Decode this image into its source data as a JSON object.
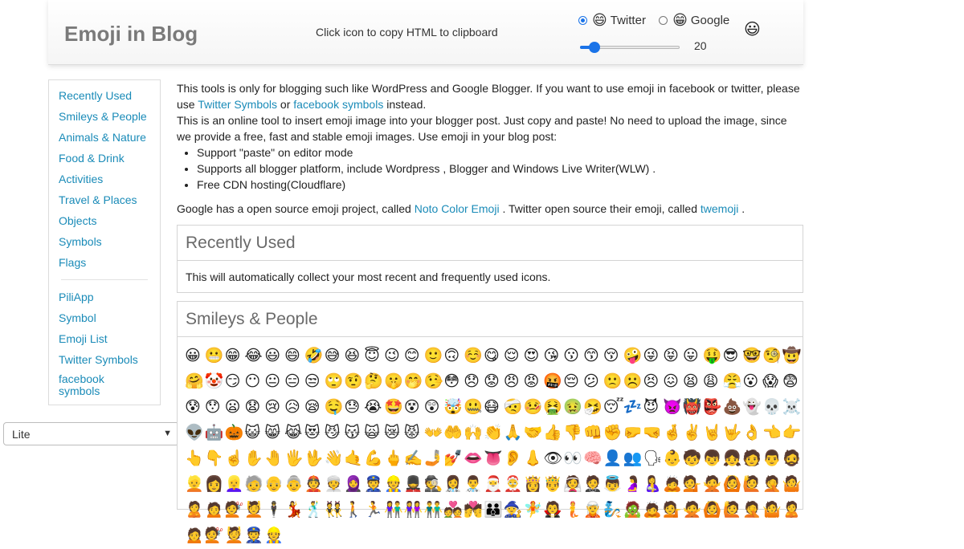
{
  "header": {
    "title": "Emoji in Blog",
    "tagline": "Click icon to copy HTML to clipboard",
    "options": [
      {
        "label": "Twitter",
        "emoji": "😄",
        "selected": true
      },
      {
        "label": "Google",
        "emoji": "😁",
        "selected": false
      }
    ],
    "preview_emoji": "😃",
    "size_slider": {
      "value": 20,
      "min": 8,
      "max": 128
    },
    "size_value": "20"
  },
  "sidebar": {
    "categories": [
      "Recently Used",
      "Smileys & People",
      "Animals & Nature",
      "Food & Drink",
      "Activities",
      "Travel & Places",
      "Objects",
      "Symbols",
      "Flags"
    ],
    "links": [
      "PiliApp",
      "Symbol",
      "Emoji List",
      "Twitter Symbols",
      "facebook symbols"
    ],
    "select_value": "Lite"
  },
  "intro": {
    "p1_before": "This tools is only for blogging such like WordPress and Google Blogger. If you want to use emoji in facebook or twitter, please use ",
    "p1_link1": "Twitter Symbols",
    "p1_or": " or ",
    "p1_link2": "facebook symbols",
    "p1_after": " instead.",
    "p2": "This is an online tool to insert emoji image into your blogger post. Just copy and paste! No need to upload the image, since we provide a free, fast and stable emoji images. Use emoji in your blog post:",
    "bullets": [
      "Support \"paste\" on editor mode",
      "Supports all blogger platform, include Wordpress , Blogger and Windows Live Writer(WLW) .",
      "Free CDN hosting(Cloudflare)"
    ],
    "p3_before": "Google has a open source emoji project, called ",
    "p3_link1": "Noto Color Emoji",
    "p3_mid": " . Twitter open source their emoji, called ",
    "p3_link2": "twemoji",
    "p3_after": " ."
  },
  "recent_panel": {
    "title": "Recently Used",
    "body": "This will automatically collect your most recent and frequently used icons."
  },
  "smileys_panel": {
    "title": "Smileys & People",
    "emojis": [
      "😀",
      "😬",
      "😁",
      "😂",
      "😃",
      "😄",
      "🤣",
      "😅",
      "😆",
      "😇",
      "😉",
      "😊",
      "🙂",
      "🙃",
      "☺️",
      "😋",
      "😌",
      "😍",
      "😘",
      "😗",
      "😙",
      "😚",
      "🤪",
      "😜",
      "😝",
      "😛",
      "🤑",
      "😎",
      "🤓",
      "🧐",
      "🤠",
      "🤗",
      "🤡",
      "😏",
      "😶",
      "😐",
      "😑",
      "😒",
      "🙄",
      "🤨",
      "🤔",
      "🤫",
      "🤭",
      "🤥",
      "😳",
      "😞",
      "😟",
      "😠",
      "😡",
      "🤬",
      "😔",
      "😕",
      "🙁",
      "☹️",
      "😣",
      "😖",
      "😫",
      "😩",
      "😤",
      "😮",
      "😱",
      "😨",
      "😰",
      "😯",
      "😦",
      "😧",
      "😢",
      "😥",
      "😪",
      "🤤",
      "😓",
      "😭",
      "🤩",
      "😵",
      "😲",
      "🤯",
      "🤐",
      "😷",
      "🤕",
      "🤒",
      "🤮",
      "🤢",
      "🤧",
      "😴",
      "💤",
      "😈",
      "👿",
      "👹",
      "👺",
      "💩",
      "👻",
      "💀",
      "☠️",
      "👽",
      "🤖",
      "🎃",
      "😺",
      "😸",
      "😹",
      "😻",
      "😼",
      "😽",
      "🙀",
      "😿",
      "😾",
      "👐",
      "🤲",
      "🙌",
      "👏",
      "🙏",
      "🤝",
      "👍",
      "👎",
      "👊",
      "✊",
      "🤛",
      "🤜",
      "🤞",
      "✌️",
      "🤘",
      "🤟",
      "👌",
      "👈",
      "👉",
      "👆",
      "👇",
      "☝️",
      "✋",
      "🤚",
      "🖐",
      "🖖",
      "👋",
      "🤙",
      "💪",
      "🖕",
      "✍️",
      "🤳",
      "💅",
      "👄",
      "👅",
      "👂",
      "👃",
      "👁",
      "👀",
      "🧠",
      "👤",
      "👥",
      "🗣",
      "👶",
      "🧒",
      "👦",
      "👧",
      "🧑",
      "👨",
      "🧔",
      "👱",
      "👩",
      "👱‍♀️",
      "🧓",
      "👴",
      "👵",
      "👲",
      "👳",
      "🧕",
      "👮",
      "👷",
      "💂",
      "🕵️",
      "👩‍⚕️",
      "👨‍⚕️",
      "🎅",
      "🤶",
      "👸",
      "🤴",
      "👰",
      "🤵",
      "👼",
      "🤰",
      "🤱",
      "🙇",
      "💁",
      "🙅",
      "🙆",
      "🙋",
      "🤦",
      "🤷",
      "🙎",
      "🙍",
      "💇",
      "💆",
      "🕴",
      "💃",
      "🕺",
      "👯",
      "🚶",
      "🏃",
      "👫",
      "👭",
      "👬",
      "💑",
      "💏",
      "👪",
      "🧙",
      "🧚",
      "🧛",
      "🧜",
      "🧝",
      "🧞",
      "🧟",
      "🙇",
      "💁",
      "🙅",
      "🙆",
      "🙋",
      "🤦",
      "🤷",
      "🙎",
      "🙍",
      "💇",
      "💆",
      "👮",
      "👷"
    ]
  }
}
